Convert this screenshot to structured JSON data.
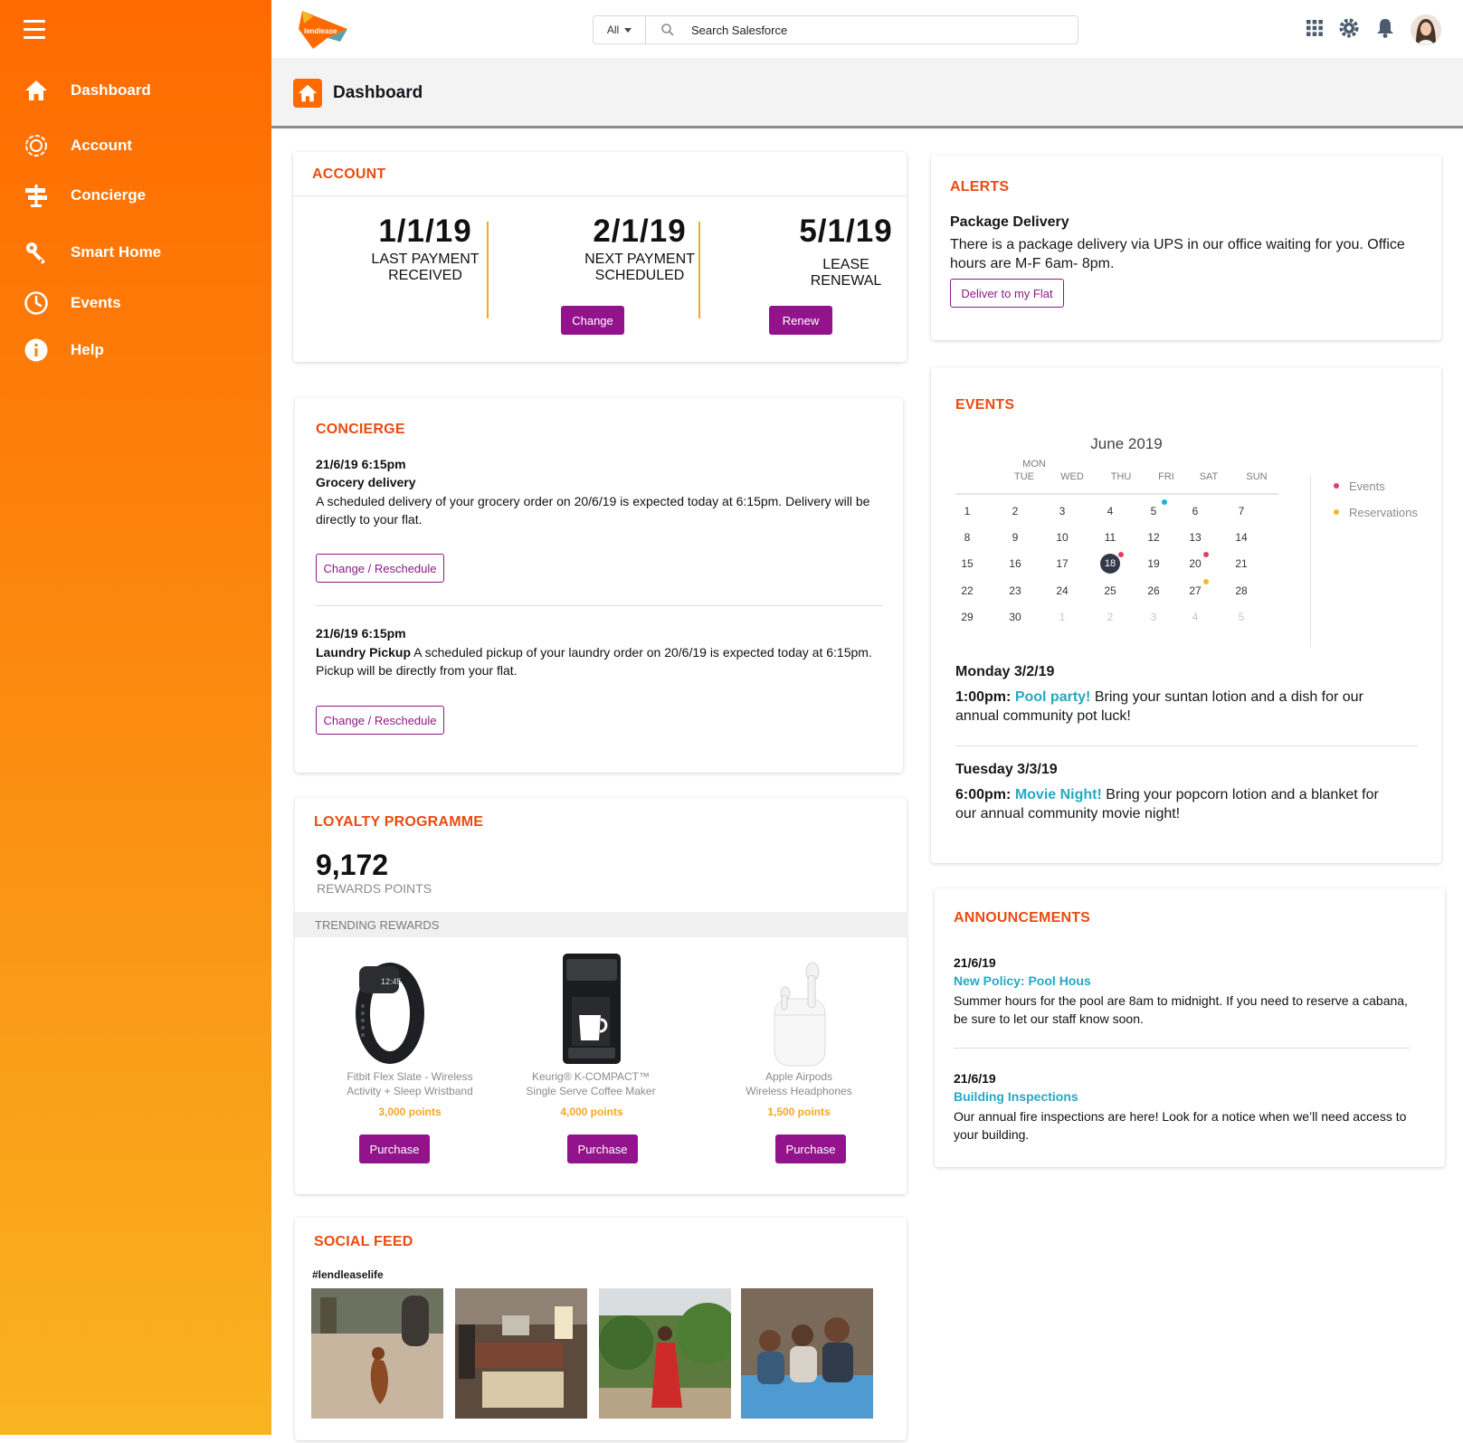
{
  "sidebar": {
    "items": [
      {
        "label": "Dashboard",
        "icon": "home-icon"
      },
      {
        "label": "Account",
        "icon": "gear-icon"
      },
      {
        "label": "Concierge",
        "icon": "signpost-icon"
      },
      {
        "label": "Smart Home",
        "icon": "key-icon"
      },
      {
        "label": "Events",
        "icon": "clock-icon"
      },
      {
        "label": "Help",
        "icon": "info-icon"
      }
    ]
  },
  "header": {
    "logo_text": "lendlease",
    "search_scope": "All",
    "search_placeholder": "Search Salesforce",
    "icons": [
      "app-launcher-icon",
      "settings-icon",
      "notification-bell-icon"
    ]
  },
  "page": {
    "title": "Dashboard"
  },
  "account": {
    "title": "ACCOUNT",
    "columns": [
      {
        "date": "1/1/19",
        "label": "LAST PAYMENT\nRECEIVED",
        "button": ""
      },
      {
        "date": "2/1/19",
        "label": "NEXT PAYMENT\nSCHEDULED",
        "button": "Change"
      },
      {
        "date": "5/1/19",
        "label": "LEASE\nRENEWAL",
        "button": "Renew"
      }
    ]
  },
  "alerts": {
    "title": "ALERTS",
    "heading": "Package Delivery",
    "body": "There is a package delivery via UPS in our office waiting for you. Office hours are M-F 6am- 8pm.",
    "button": "Deliver to my Flat"
  },
  "concierge": {
    "title": "CONCIERGE",
    "items": [
      {
        "time": "21/6/19 6:15pm",
        "heading": "Grocery delivery",
        "body": "A scheduled delivery of your grocery order on 20/6/19 is expected today at 6:15pm. Delivery will be directly to your flat.",
        "button": "Change / Reschedule"
      },
      {
        "time": "21/6/19 6:15pm",
        "heading": "Laundry Pickup",
        "body": "A scheduled pickup of your laundry order on 20/6/19 is expected today at 6:15pm. Pickup will be directly from your flat.",
        "button": "Change / Reschedule"
      }
    ]
  },
  "events": {
    "title": "EVENTS",
    "month": "June 2019",
    "weekdays": [
      "TUE",
      "WED",
      "THU",
      "FRI",
      "SAT",
      "SUN"
    ],
    "weekday_extra": "MON",
    "weeks": [
      [
        "1",
        "2",
        "3",
        "4",
        "5",
        "6",
        "7"
      ],
      [
        "8",
        "9",
        "10",
        "11",
        "12",
        "13",
        "14"
      ],
      [
        "15",
        "16",
        "17",
        "18",
        "19",
        "20",
        "21"
      ],
      [
        "22",
        "23",
        "24",
        "25",
        "26",
        "27",
        "28"
      ],
      [
        "29",
        "30",
        "1",
        "2",
        "3",
        "4",
        "5"
      ]
    ],
    "today": "18",
    "legend": [
      {
        "label": "Events",
        "color": "#e0405e"
      },
      {
        "label": "Reservations",
        "color": "#f5b821"
      }
    ],
    "colors": {
      "today_bg": "#34394a",
      "teal_dot": "#1bb3d6"
    },
    "entries": [
      {
        "date": "Monday 3/2/19",
        "time": "1:00pm:",
        "name": "Pool party!",
        "body": "Bring your suntan lotion and a dish for our annual community pot luck!"
      },
      {
        "date": "Tuesday 3/3/19",
        "time": "6:00pm:",
        "name": "Movie Night!",
        "body": "Bring your popcorn lotion and a blanket for our annual community movie night!"
      }
    ]
  },
  "loyalty": {
    "title": "LOYALTY PROGRAMME",
    "points": "9,172",
    "points_label": "REWARDS POINTS",
    "trending_label": "TRENDING REWARDS",
    "rewards": [
      {
        "name": "Fitbit Flex Slate - Wireless\nActivity + Sleep Wristband",
        "points": "3,000 points",
        "button": "Purchase"
      },
      {
        "name": "Keurig® K-COMPACT™\nSingle Serve Coffee Maker",
        "points": "4,000 points",
        "button": "Purchase"
      },
      {
        "name": "Apple Airpods\nWireless Headphones",
        "points": "1,500 points",
        "button": "Purchase"
      }
    ]
  },
  "announcements": {
    "title": "ANNOUNCEMENTS",
    "items": [
      {
        "date": "21/6/19",
        "heading": "New Policy: Pool Hous",
        "body": "Summer hours for the pool are 8am to midnight. If you need to reserve a cabana, be sure to let our staff know soon."
      },
      {
        "date": "21/6/19",
        "heading": "Building Inspections",
        "body": "Our annual fire inspections are here! Look for a notice when we’ll need access to your building."
      }
    ]
  },
  "social": {
    "title": "SOCIAL FEED",
    "hashtag": "#lendleaselife"
  },
  "colors": {
    "brand_orange": "#ff6a00",
    "section_title": "#ea4b12",
    "button_purple": "#93138c",
    "divider_gold": "#f5a623",
    "link_teal": "#27a8c2"
  }
}
